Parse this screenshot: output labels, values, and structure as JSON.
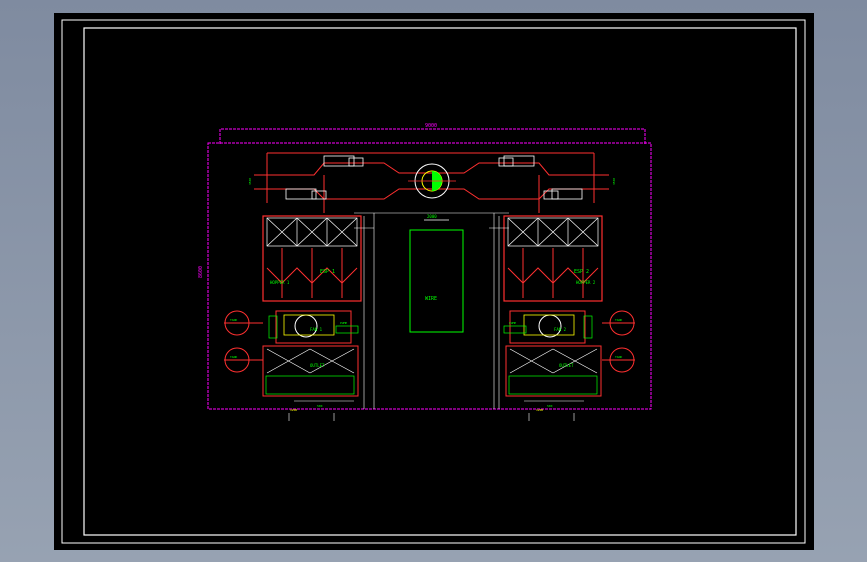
{
  "drawing": {
    "overall_width_dim": "9000",
    "overall_height_dim": "8600",
    "center_block_label": "WIRE",
    "center_block_top_dim": "2000",
    "left_unit": {
      "esp_label": "ESP 1",
      "fan_label": "FAN 1",
      "hopper_label": "HOPPER 1",
      "outlet_label": "OUTLET",
      "tag_left": "PUMP",
      "tag_right": "PUMP"
    },
    "right_unit": {
      "esp_label": "ESP 2",
      "fan_label": "FAN 2",
      "hopper_label": "HOPPER 2",
      "outlet_label": "OUTLET",
      "tag_left": "PUMP",
      "tag_right": "PUMP"
    },
    "tank_labels": [
      "TANK",
      "TANK",
      "TANK",
      "TANK"
    ],
    "dim_small": "500",
    "dim_bottom": "1200",
    "side_dim": "3500"
  },
  "colors": {
    "sheet": "#000000",
    "border": "#ffffff",
    "equipment": "#ff3030",
    "hatching": "#ffffff",
    "annotation": "#00ff00",
    "dimension": "#ff00ff",
    "detail": "#ffff00"
  }
}
